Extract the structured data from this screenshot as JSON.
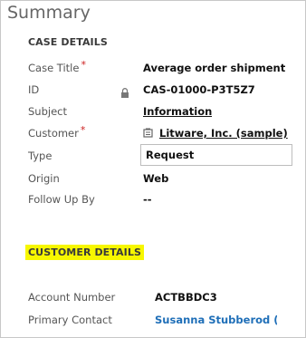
{
  "page": {
    "title": "Summary"
  },
  "case_details": {
    "heading": "CASE DETAILS",
    "required_marker": "*",
    "case_title": {
      "label": "Case Title",
      "value": "Average order shipment time"
    },
    "id": {
      "label": "ID",
      "value": "CAS-01000-P3T5Z7"
    },
    "subject": {
      "label": "Subject",
      "value": "Information"
    },
    "customer": {
      "label": "Customer",
      "value": "Litware, Inc. (sample)"
    },
    "type": {
      "label": "Type",
      "value": "Request"
    },
    "origin": {
      "label": "Origin",
      "value": "Web"
    },
    "follow_up_by": {
      "label": "Follow Up By",
      "value": "--"
    }
  },
  "customer_details": {
    "heading": "CUSTOMER DETAILS",
    "account_number": {
      "label": "Account Number",
      "value": "ACTBBDC3"
    },
    "primary_contact": {
      "label": "Primary Contact",
      "value": "Susanna Stubberod (sam"
    }
  },
  "icons": {
    "lock": "lock-icon",
    "account": "account-icon"
  },
  "colors": {
    "highlight": "#f7f700",
    "required": "#cc1e1e",
    "link": "#1f6fb8"
  }
}
